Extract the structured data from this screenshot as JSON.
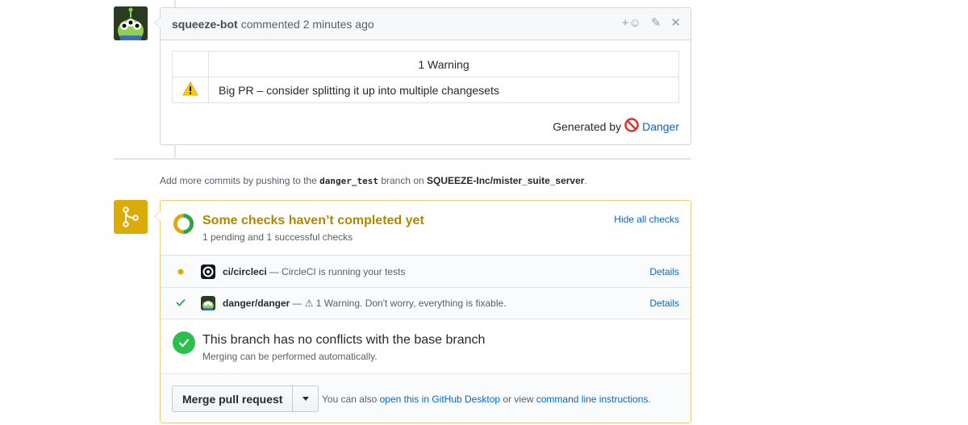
{
  "comment": {
    "author": "squeeze-bot",
    "meta": "commented 2 minutes ago",
    "reaction_label": "+☺",
    "table_header": "1 Warning",
    "warning_text": "Big PR – consider splitting it up into multiple changesets",
    "generated_by_prefix": "Generated by",
    "generated_by_link": "Danger"
  },
  "push_note": {
    "prefix": "Add more commits by pushing to the",
    "branch": "danger_test",
    "middle": "branch on",
    "repo": "SQUEEZE-Inc/mister_suite_server",
    "suffix": "."
  },
  "checks": {
    "title": "Some checks haven’t completed yet",
    "subtitle": "1 pending and 1 successful checks",
    "hide_label": "Hide all checks",
    "rows": [
      {
        "name": "ci/circleci",
        "desc": "— CircleCI is running your tests",
        "details": "Details",
        "state": "pending"
      },
      {
        "name": "danger/danger",
        "desc": "— ⚠ 1 Warning. Don't worry, everything is fixable.",
        "details": "Details",
        "state": "success"
      }
    ]
  },
  "conflicts": {
    "title": "This branch has no conflicts with the base branch",
    "subtitle": "Merging can be performed automatically."
  },
  "merge": {
    "button_label": "Merge pull request",
    "hint_prefix": "You can also",
    "desktop_link": "open this in GitHub Desktop",
    "hint_middle": "or view",
    "cli_link": "command line instructions",
    "hint_suffix": "."
  },
  "colors": {
    "link": "#0366d6",
    "pending": "#dbab09",
    "success": "#28a745"
  }
}
